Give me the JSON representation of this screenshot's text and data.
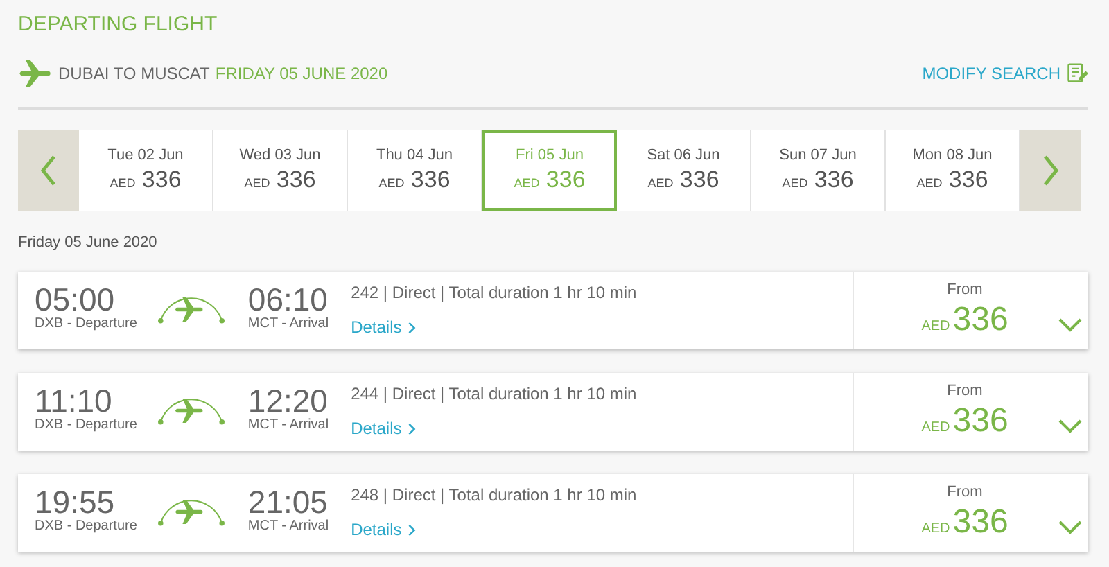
{
  "title": "DEPARTING FLIGHT",
  "route": {
    "text": "DUBAI TO MUSCAT",
    "date": "FRIDAY 05 JUNE 2020"
  },
  "modify_search": "MODIFY SEARCH",
  "dates": [
    {
      "day": "Tue 02 Jun",
      "currency": "AED",
      "price": "336",
      "selected": false
    },
    {
      "day": "Wed 03 Jun",
      "currency": "AED",
      "price": "336",
      "selected": false
    },
    {
      "day": "Thu 04 Jun",
      "currency": "AED",
      "price": "336",
      "selected": false
    },
    {
      "day": "Fri 05 Jun",
      "currency": "AED",
      "price": "336",
      "selected": true
    },
    {
      "day": "Sat 06 Jun",
      "currency": "AED",
      "price": "336",
      "selected": false
    },
    {
      "day": "Sun 07 Jun",
      "currency": "AED",
      "price": "336",
      "selected": false
    },
    {
      "day": "Mon 08 Jun",
      "currency": "AED",
      "price": "336",
      "selected": false
    }
  ],
  "date_heading": "Friday 05 June 2020",
  "flights": [
    {
      "depart": "05:00",
      "depart_label": "DXB - Departure",
      "arrive": "06:10",
      "arrive_label": "MCT - Arrival",
      "info": "242 | Direct | Total duration 1 hr 10 min",
      "details": "Details",
      "from": "From",
      "currency": "AED",
      "price": "336"
    },
    {
      "depart": "11:10",
      "depart_label": "DXB - Departure",
      "arrive": "12:20",
      "arrive_label": "MCT - Arrival",
      "info": "244 | Direct | Total duration 1 hr 10 min",
      "details": "Details",
      "from": "From",
      "currency": "AED",
      "price": "336"
    },
    {
      "depart": "19:55",
      "depart_label": "DXB - Departure",
      "arrive": "21:05",
      "arrive_label": "MCT - Arrival",
      "info": "248 | Direct | Total duration 1 hr 10 min",
      "details": "Details",
      "from": "From",
      "currency": "AED",
      "price": "336"
    }
  ]
}
